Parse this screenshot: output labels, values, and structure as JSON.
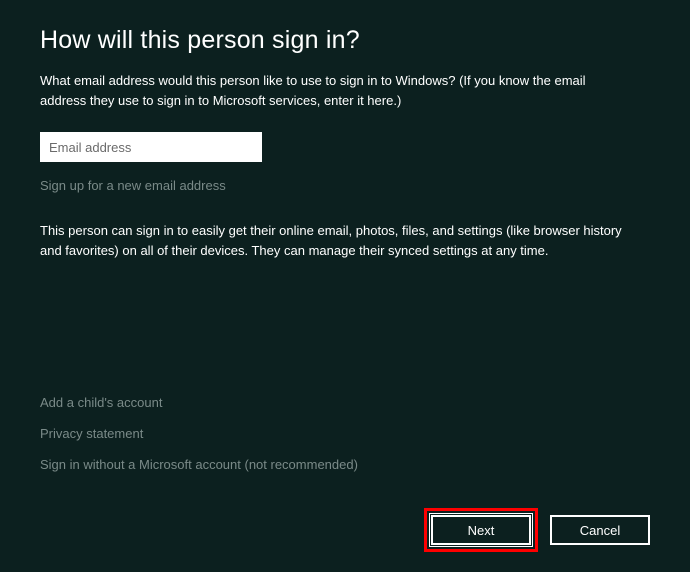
{
  "title": "How will this person sign in?",
  "intro": "What email address would this person like to use to sign in to Windows? (If you know the email address they use to sign in to Microsoft services, enter it here.)",
  "email": {
    "placeholder": "Email address",
    "value": ""
  },
  "signup_link": "Sign up for a new email address",
  "description": "This person can sign in to easily get their online email, photos, files, and settings (like browser history and favorites) on all of their devices. They can manage their synced settings at any time.",
  "links": {
    "child_account": "Add a child's account",
    "privacy": "Privacy statement",
    "no_ms_account": "Sign in without a Microsoft account (not recommended)"
  },
  "buttons": {
    "next": "Next",
    "cancel": "Cancel"
  }
}
